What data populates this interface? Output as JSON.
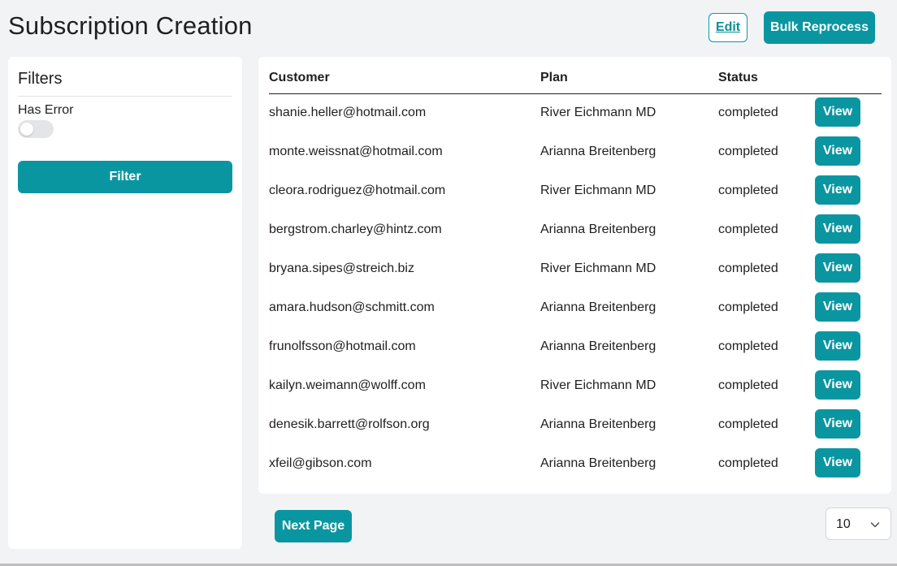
{
  "header": {
    "title": "Subscription Creation",
    "edit_label": "Edit",
    "bulk_reprocess_label": "Bulk Reprocess"
  },
  "filters": {
    "title": "Filters",
    "has_error_label": "Has Error",
    "has_error_value": false,
    "filter_button_label": "Filter"
  },
  "table": {
    "columns": [
      "Customer",
      "Plan",
      "Status"
    ],
    "view_label": "View",
    "rows": [
      {
        "customer": "shanie.heller@hotmail.com",
        "plan": "River Eichmann MD",
        "status": "completed"
      },
      {
        "customer": "monte.weissnat@hotmail.com",
        "plan": "Arianna Breitenberg",
        "status": "completed"
      },
      {
        "customer": "cleora.rodriguez@hotmail.com",
        "plan": "River Eichmann MD",
        "status": "completed"
      },
      {
        "customer": "bergstrom.charley@hintz.com",
        "plan": "Arianna Breitenberg",
        "status": "completed"
      },
      {
        "customer": "bryana.sipes@streich.biz",
        "plan": "River Eichmann MD",
        "status": "completed"
      },
      {
        "customer": "amara.hudson@schmitt.com",
        "plan": "Arianna Breitenberg",
        "status": "completed"
      },
      {
        "customer": "frunolfsson@hotmail.com",
        "plan": "Arianna Breitenberg",
        "status": "completed"
      },
      {
        "customer": "kailyn.weimann@wolff.com",
        "plan": "River Eichmann MD",
        "status": "completed"
      },
      {
        "customer": "denesik.barrett@rolfson.org",
        "plan": "Arianna Breitenberg",
        "status": "completed"
      },
      {
        "customer": "xfeil@gibson.com",
        "plan": "Arianna Breitenberg",
        "status": "completed"
      }
    ]
  },
  "pagination": {
    "next_page_label": "Next Page",
    "per_page_value": "10"
  },
  "colors": {
    "accent": "#0a96a1",
    "background": "#f2f3f5",
    "card": "#ffffff"
  }
}
